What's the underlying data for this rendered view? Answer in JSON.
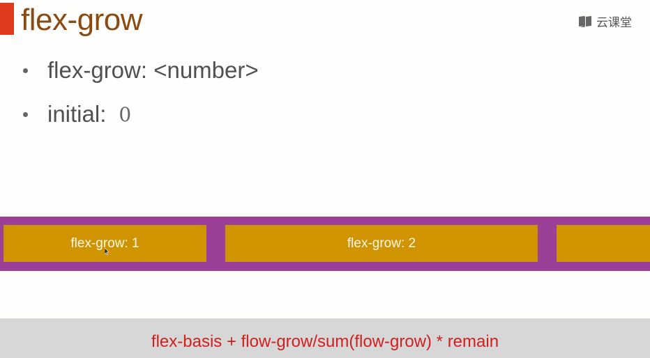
{
  "slide": {
    "title": "flex-grow",
    "brand": {
      "icon": "book-icon",
      "text": "云课堂"
    },
    "bullets": [
      {
        "label": "flex-grow: <number>",
        "value": ""
      },
      {
        "label": "initial:",
        "value": "0"
      }
    ],
    "demo": {
      "items": [
        {
          "label": "flex-grow: 1"
        },
        {
          "label": "flex-grow: 2"
        },
        {
          "label": ""
        }
      ]
    },
    "footer": {
      "formula": "flex-basis + flow-grow/sum(flow-grow) * remain"
    }
  },
  "colors": {
    "title": "#8a4a12",
    "marker": "#e03a1c",
    "container": "#9b3f97",
    "item": "#cf9400",
    "formula": "#d02020",
    "footer_bg": "#d7d7d7"
  }
}
